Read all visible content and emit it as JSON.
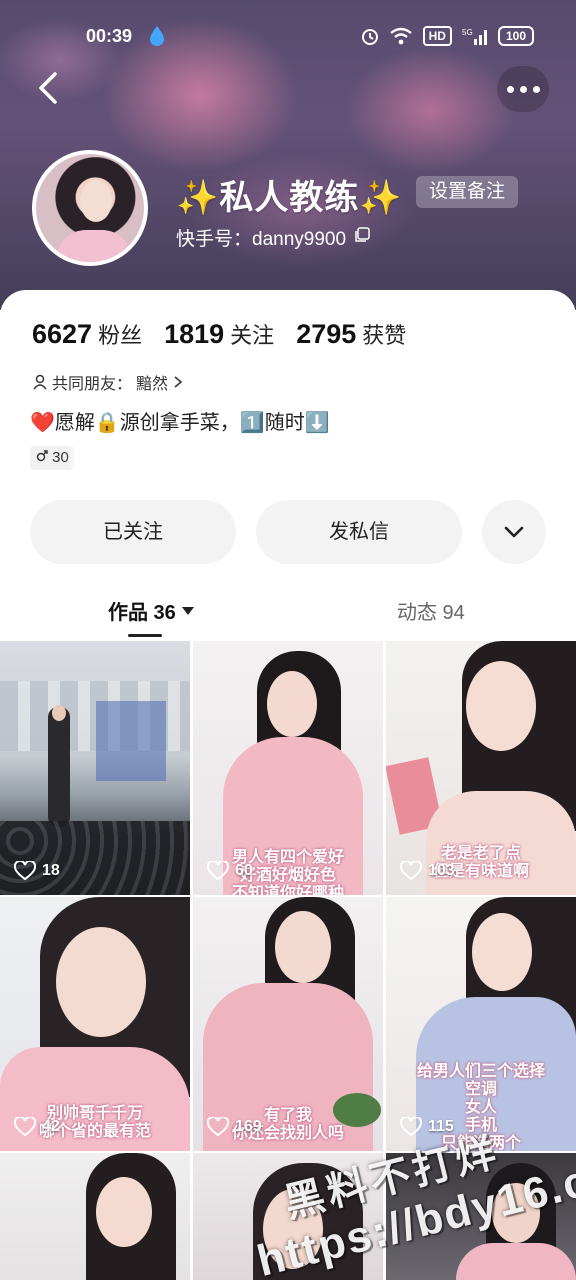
{
  "status_bar": {
    "time": "00:39",
    "indicators": [
      "HD",
      "5G",
      "100"
    ],
    "network": "5G",
    "battery": "100"
  },
  "header": {
    "name": "✨私人教练✨",
    "remark_button": "设置备注",
    "user_id": "快手号：danny9900"
  },
  "stats": [
    {
      "num": "6627",
      "label": "粉丝"
    },
    {
      "num": "1819",
      "label": "关注"
    },
    {
      "num": "2795",
      "label": "获赞"
    }
  ],
  "mutual_friends": {
    "label": "共同朋友：",
    "name": "黯然"
  },
  "bio": "❤️愿解🔒源创拿手菜，1️⃣随时⬇️",
  "tag": "30",
  "actions": {
    "follow": "已关注",
    "message": "发私信"
  },
  "tabs": {
    "works": "作品 36",
    "dynamics": "动态 94"
  },
  "videos": [
    {
      "likes": "18",
      "caption": []
    },
    {
      "likes": "60",
      "caption": [
        "男人有四个爱好",
        "好酒好烟好色",
        "不知道你好哪种"
      ]
    },
    {
      "likes": "103",
      "caption": [
        "老是老了点",
        "但是有味道啊"
      ]
    },
    {
      "likes": "42",
      "caption": [
        "别帅哥千千万",
        "哪个省的最有范"
      ]
    },
    {
      "likes": "169",
      "caption": [
        "有了我",
        "你还会找别人吗"
      ]
    },
    {
      "likes": "115",
      "caption": [
        "给男人们三个选择",
        "空调",
        "女人",
        "手机",
        "只能选两个"
      ]
    },
    {
      "likes": "",
      "caption": []
    },
    {
      "likes": "",
      "caption": []
    },
    {
      "likes": "",
      "caption": []
    }
  ],
  "watermark": {
    "line1": "黑料不打烊",
    "line2": "https://bdy16.co"
  }
}
